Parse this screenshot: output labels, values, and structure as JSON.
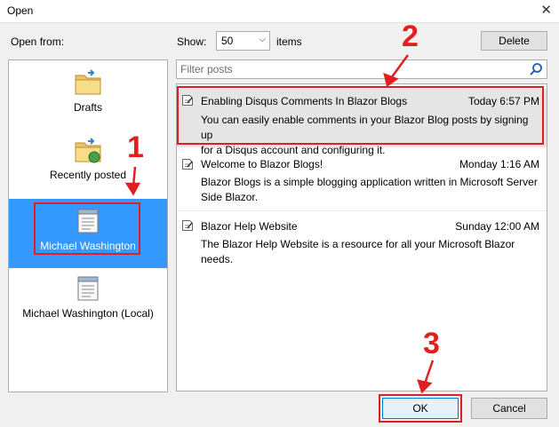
{
  "dialog": {
    "title": "Open",
    "close_glyph": "✕"
  },
  "left": {
    "heading": "Open from:",
    "places": [
      {
        "label": "Drafts",
        "icon": "folder-drafts-icon"
      },
      {
        "label": "Recently posted",
        "icon": "folder-recent-icon"
      },
      {
        "label": "Michael Washington",
        "icon": "blog-icon",
        "selected": true
      },
      {
        "label": "Michael Washington (Local)",
        "icon": "blog-local-icon"
      }
    ]
  },
  "toolbar": {
    "show_label": "Show:",
    "show_value": "50",
    "items_label": "items",
    "delete_label": "Delete"
  },
  "filter": {
    "placeholder": "Filter posts",
    "icon": "search-icon"
  },
  "posts": [
    {
      "title": "Enabling Disqus Comments In Blazor Blogs",
      "date": "Today 6:57 PM",
      "desc_lines": [
        "You can easily enable comments in your Blazor Blog posts by signing up",
        "for a Disqus account and configuring it."
      ]
    },
    {
      "title": "Welcome to Blazor Blogs!",
      "date": "Monday 1:16 AM",
      "desc_lines": [
        "Blazor Blogs is a simple blogging application written in Microsoft Server",
        "Side Blazor."
      ]
    },
    {
      "title": "Blazor Help Website",
      "date": "Sunday 12:00 AM",
      "desc_lines": [
        "The Blazor Help Website is a resource for all your Microsoft Blazor needs."
      ]
    }
  ],
  "buttons": {
    "ok": "OK",
    "cancel": "Cancel"
  },
  "annotations": {
    "n1": "1",
    "n2": "2",
    "n3": "3",
    "color": "#e02020"
  },
  "colors": {
    "selection": "#3399ff",
    "annotation": "#e02020"
  }
}
